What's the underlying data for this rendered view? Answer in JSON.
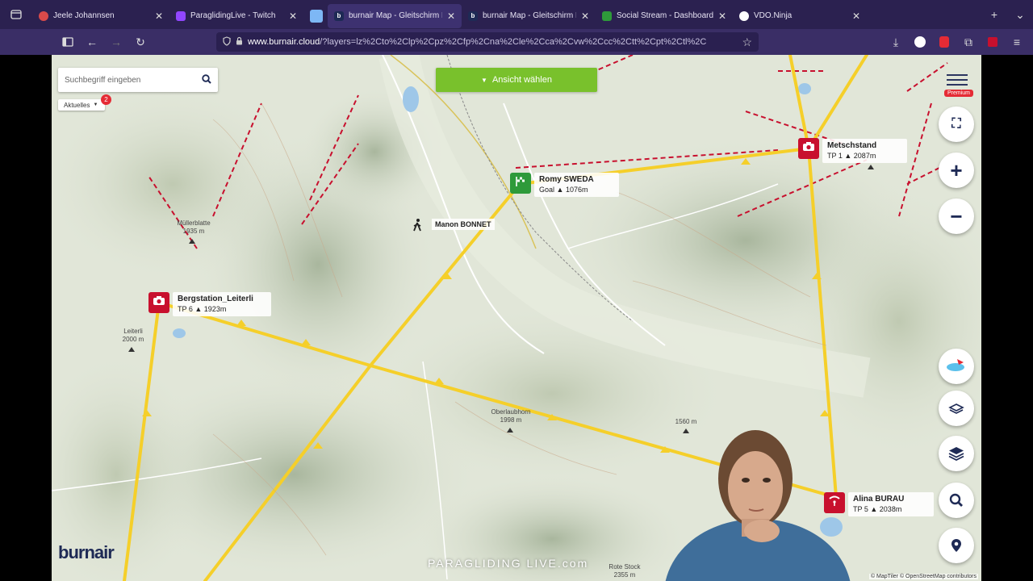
{
  "tabs": [
    {
      "label": "Jeele Johannsen",
      "fav_color": "#d84a4a",
      "active": false
    },
    {
      "label": "ParaglidingLive - Twitch",
      "fav_color": "#9146ff",
      "active": false
    },
    {
      "label": "",
      "fav_color": "#7db7f5",
      "active": false
    },
    {
      "label": "burnair Map - Gleitschirm Flug",
      "fav_color": "#1e2a55",
      "active": true
    },
    {
      "label": "burnair Map - Gleitschirm Flug",
      "fav_color": "#1e2a55",
      "active": false
    },
    {
      "label": "Social Stream - Dashboard",
      "fav_color": "#2e9a3a",
      "active": false
    },
    {
      "label": "VDO.Ninja",
      "fav_color": "#ffffff",
      "active": false
    }
  ],
  "url": {
    "host": "www.burnair.cloud",
    "path": "/?layers=lz%2Cto%2Clp%2Cpz%2Cfp%2Cna%2Cle%2Cca%2Cvw%2Ccc%2Ctt%2Cpt%2Ctl%2C"
  },
  "map": {
    "search_placeholder": "Suchbegriff eingeben",
    "filter_label": "Aktuelles",
    "filter_badge": "2",
    "view_button": "Ansicht wählen",
    "premium": "Premium",
    "turnpoints": [
      {
        "name": "Metschstand",
        "tp": "TP 1",
        "alt": "2087m"
      },
      {
        "name": "Bergstation_Leiterli",
        "tp": "TP 6",
        "alt": "1923m"
      },
      {
        "name": "Alina BURAU",
        "tp": "TP 5",
        "alt": "2038m"
      }
    ],
    "goal": {
      "name": "Romy SWEDA",
      "tp": "Goal",
      "alt": "1076m"
    },
    "pilot": "Manon BONNET",
    "places": [
      {
        "name": "Müllerblatte",
        "alt": "1935 m"
      },
      {
        "name": "Leiterli",
        "alt": "2000 m"
      },
      {
        "name": "Oberlaubhorn",
        "alt": "1998 m"
      },
      {
        "name": "",
        "alt": "1560 m"
      },
      {
        "name": "Rote Stock",
        "alt": "2355 m"
      }
    ],
    "attribution": "© MapTiler © OpenStreetMap contributors",
    "logo": "burnair",
    "watermark": "PARAGLIDING LIVE.com"
  }
}
